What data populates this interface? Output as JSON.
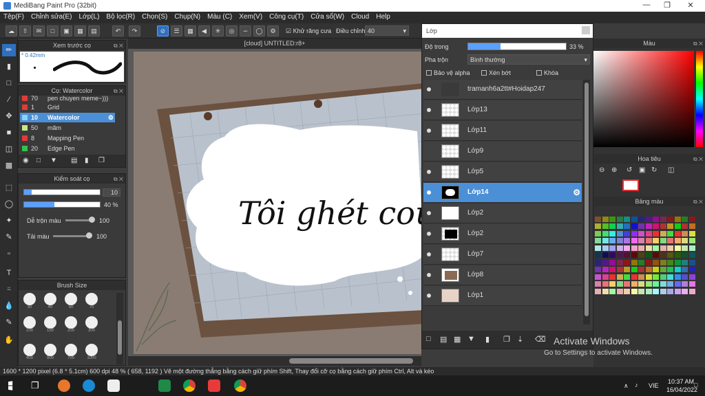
{
  "window": {
    "title": "MediBang Paint Pro (32bit)"
  },
  "menu": [
    "Tệp(F)",
    "Chỉnh sửa(E)",
    "Lớp(L)",
    "Bộ lọc(R)",
    "Chọn(S)",
    "Chụp(N)",
    "Màu (C)",
    "Xem(V)",
    "Công cụ(T)",
    "Cửa sổ(W)",
    "Cloud",
    "Help"
  ],
  "toolbar": {
    "antialias_label": "Khử răng cưa",
    "adjust_label": "Điều chỉnh",
    "adjust_value": "40"
  },
  "brush_preview": {
    "title": "Xem trước cọ",
    "size": "0.42mm"
  },
  "brush_panel": {
    "title": "Cọ: Watercolor",
    "items": [
      {
        "num": "70",
        "name": "pen chuyen meme~)))",
        "color": "#e03a3a"
      },
      {
        "num": "1",
        "name": "Grid",
        "color": "#e03a3a"
      },
      {
        "num": "10",
        "name": "Watercolor",
        "color": "#8ad0ff"
      },
      {
        "num": "50",
        "name": "mãm",
        "color": "#c8e68a"
      },
      {
        "num": "8",
        "name": "Mapping Pen",
        "color": "#e03a3a"
      },
      {
        "num": "20",
        "name": "Edge Pen",
        "color": "#35c24a"
      }
    ]
  },
  "control": {
    "title": "Kiểm soát cọ",
    "size_value": "10",
    "opacity_value": "40 %",
    "opacity_fraction": 0.4,
    "mix_label": "Dễ trộn màu",
    "mix_value": "100",
    "load_label": "Tải màu",
    "load_value": "100"
  },
  "brush_size": {
    "title": "Brush Size",
    "sizes": [
      "30",
      "40",
      "50",
      "70",
      "100",
      "150",
      "200",
      "300",
      "400",
      "500",
      "700",
      "1000"
    ]
  },
  "canvas": {
    "tab_title": "[cloud] UNTITLED:r8+",
    "artwork_text": "Tôi ghét cou"
  },
  "layer": {
    "title": "Lớp",
    "opacity_label": "Độ trong",
    "opacity_value": "33 %",
    "opacity_fraction": 0.33,
    "blend_label": "Pha trộn",
    "blend_value": "Bình thường",
    "protect_alpha": "Bảo vệ alpha",
    "clipping": "Xén bớt",
    "lock": "Khóa",
    "items": [
      {
        "name": "tramanh6a2tt#Hoidap247"
      },
      {
        "name": "Lớp13"
      },
      {
        "name": "Lớp11"
      },
      {
        "name": "Lớp9"
      },
      {
        "name": "Lớp5"
      },
      {
        "name": "Lớp14",
        "selected": true
      },
      {
        "name": "Lớp2"
      },
      {
        "name": "Lớp2"
      },
      {
        "name": "Lớp7"
      },
      {
        "name": "Lớp8"
      },
      {
        "name": "Lớp1"
      }
    ]
  },
  "color_panel": {
    "title": "Màu"
  },
  "navigator": {
    "title": "Hoa tiêu"
  },
  "palette": {
    "title": "Bảng màu"
  },
  "watermark": {
    "line1": "Activate Windows",
    "line2": "Go to Settings to activate Windows."
  },
  "status": {
    "text": "1600 * 1200 pixel  (6.8 * 5.1cm)  600 dpi  48 %  ( 658, 1192 )  Vẽ một đường thẳng bằng cách giữ phím Shift, Thay đổi cỡ cọ bằng cách giữ phím Ctrl, Alt và kéo"
  },
  "taskbar": {
    "lang": "VIE",
    "time": "10:37 AM",
    "date": "16/04/2022"
  },
  "colors": {
    "accent": "#4b8fd6",
    "canvas_bg": "#8a7c72"
  }
}
